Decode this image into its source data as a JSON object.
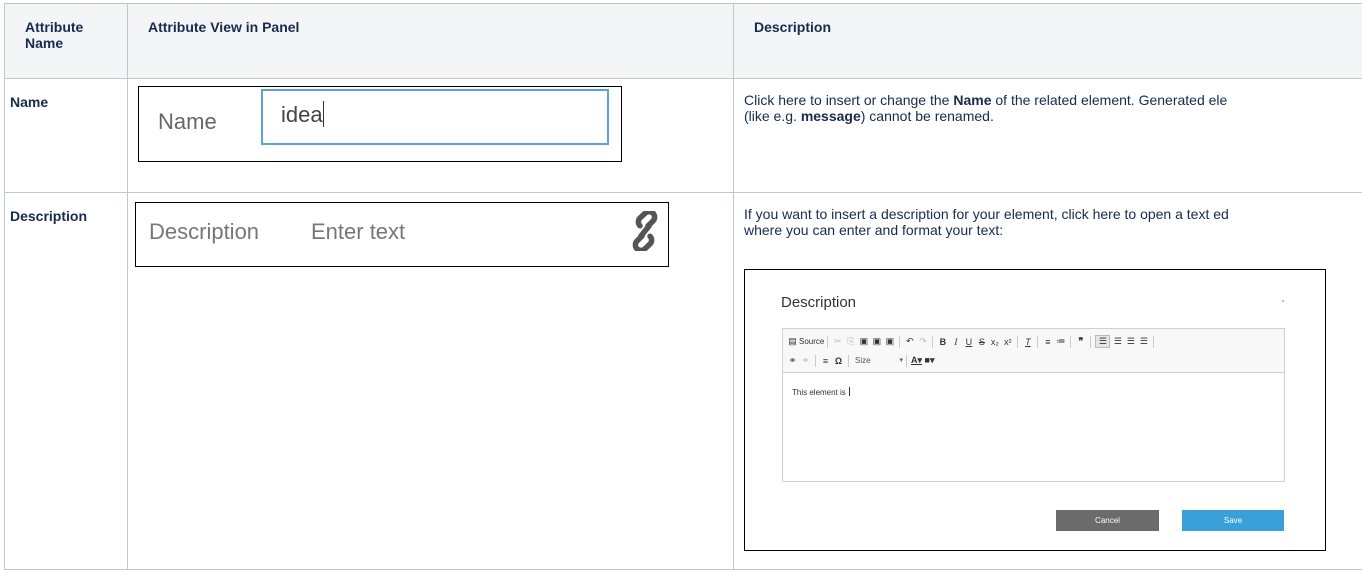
{
  "table": {
    "headers": [
      "Attribute Name",
      "Attribute View in Panel",
      "Description"
    ],
    "rows": [
      {
        "attribute_name": "Name",
        "panel": {
          "label": "Name",
          "value": "idea"
        },
        "description": {
          "segments": [
            {
              "t": "Click here to insert or change the ",
              "b": false
            },
            {
              "t": "Name",
              "b": true
            },
            {
              "t": " of the related element. Generated ele\n(like e.g. ",
              "b": false
            },
            {
              "t": "message",
              "b": true
            },
            {
              "t": ") cannot be renamed.",
              "b": false
            }
          ]
        }
      },
      {
        "attribute_name": "Description",
        "panel": {
          "label": "Description",
          "placeholder": "Enter text",
          "icon": "link-icon"
        },
        "description": {
          "segments": [
            {
              "t": "If you want to insert a description for your element, click here to open a text ed\nwhere you can enter and format your text:",
              "b": false
            }
          ]
        },
        "editor": {
          "title": "Description",
          "toolbar_source": "Source",
          "size_label": "Size",
          "body_text": "This element is",
          "cancel_label": "Cancel",
          "save_label": "Save"
        }
      }
    ]
  },
  "colors": {
    "border": "#c1c7d0",
    "header_bg": "#f4f5f7",
    "input_focus": "#5aa3d6",
    "save": "#3aa0d9",
    "cancel": "#6b6b6b"
  }
}
